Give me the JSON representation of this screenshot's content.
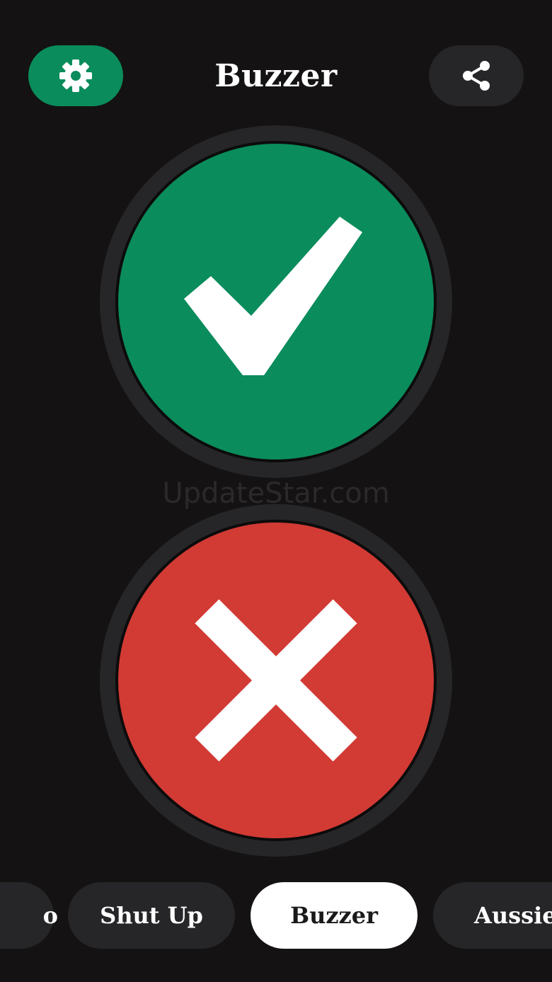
{
  "header": {
    "title": "Buzzer",
    "settings_icon": "gear-icon",
    "share_icon": "share-icon"
  },
  "buttons": {
    "yes_icon": "checkmark-icon",
    "no_icon": "cross-icon"
  },
  "watermark": "UpdateStar.com",
  "sounds": {
    "items": [
      {
        "label": "o"
      },
      {
        "label": "Shut Up"
      },
      {
        "label": "Buzzer"
      },
      {
        "label": "Aussie"
      }
    ],
    "selected": "Buzzer"
  },
  "colors": {
    "background": "#141212",
    "green": "#0a8c5c",
    "red": "#d23a34",
    "chip": "#262628",
    "chip_active": "#ffffff"
  }
}
